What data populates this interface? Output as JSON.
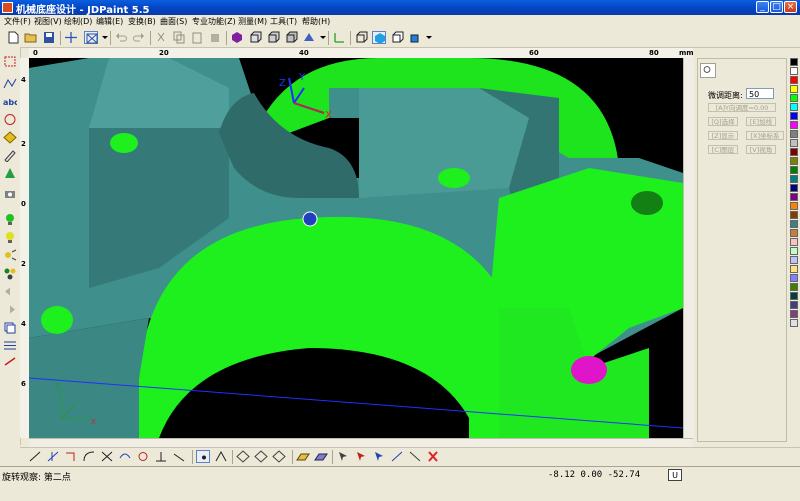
{
  "window": {
    "title": "机械底座设计 - JDPaint 5.5",
    "minimize": "_",
    "maximize": "□",
    "close": "×"
  },
  "menu": [
    "文件(F)",
    "视图(V)",
    "绘制(D)",
    "编辑(E)",
    "变换(B)",
    "曲面(S)",
    "专业功能(Z)",
    "测量(M)",
    "工具(T)",
    "帮助(H)"
  ],
  "ruler": {
    "unit": "mm",
    "h_labels": [
      "0",
      "20",
      "40",
      "60",
      "80"
    ],
    "v_labels": [
      "4",
      "2",
      "0",
      "2",
      "4",
      "6"
    ]
  },
  "viewport_axes": {
    "x": "X",
    "y": "Y",
    "z": "Z"
  },
  "panel": {
    "tab_icon": "move-view-icon",
    "distance_label": "微调距离:",
    "distance_value": "50",
    "buttons": [
      "[A]Y向调度=0.00",
      "[Q]选择",
      "[E]加线",
      "[Z]显示",
      "[X]坐标系",
      "[C]图层",
      "[V]视角"
    ]
  },
  "palette": [
    "#000000",
    "#ffffff",
    "#ff0000",
    "#ffff00",
    "#00ff00",
    "#00ffff",
    "#0000ff",
    "#ff00ff",
    "#808080",
    "#c0c0c0",
    "#800000",
    "#808000",
    "#008000",
    "#008080",
    "#000080",
    "#800080",
    "#ff8000",
    "#804000",
    "#408080",
    "#c08040",
    "#ffc0c0",
    "#c0ffc0",
    "#c0c0ff",
    "#ffe080",
    "#8080ff",
    "#408000",
    "#004040",
    "#404080",
    "#804080",
    "#e0e0e0"
  ],
  "status": {
    "prompt": "旋转观察: 第二点",
    "coords": "-8.12 0.00 -52.74",
    "mode": "U"
  },
  "colors": {
    "viewport_bg": "#000000",
    "part_teal": "#3f8f8c",
    "part_green": "#1ef01e",
    "hole_magenta": "#e014c8",
    "title_blue": "#0a4fd0"
  }
}
